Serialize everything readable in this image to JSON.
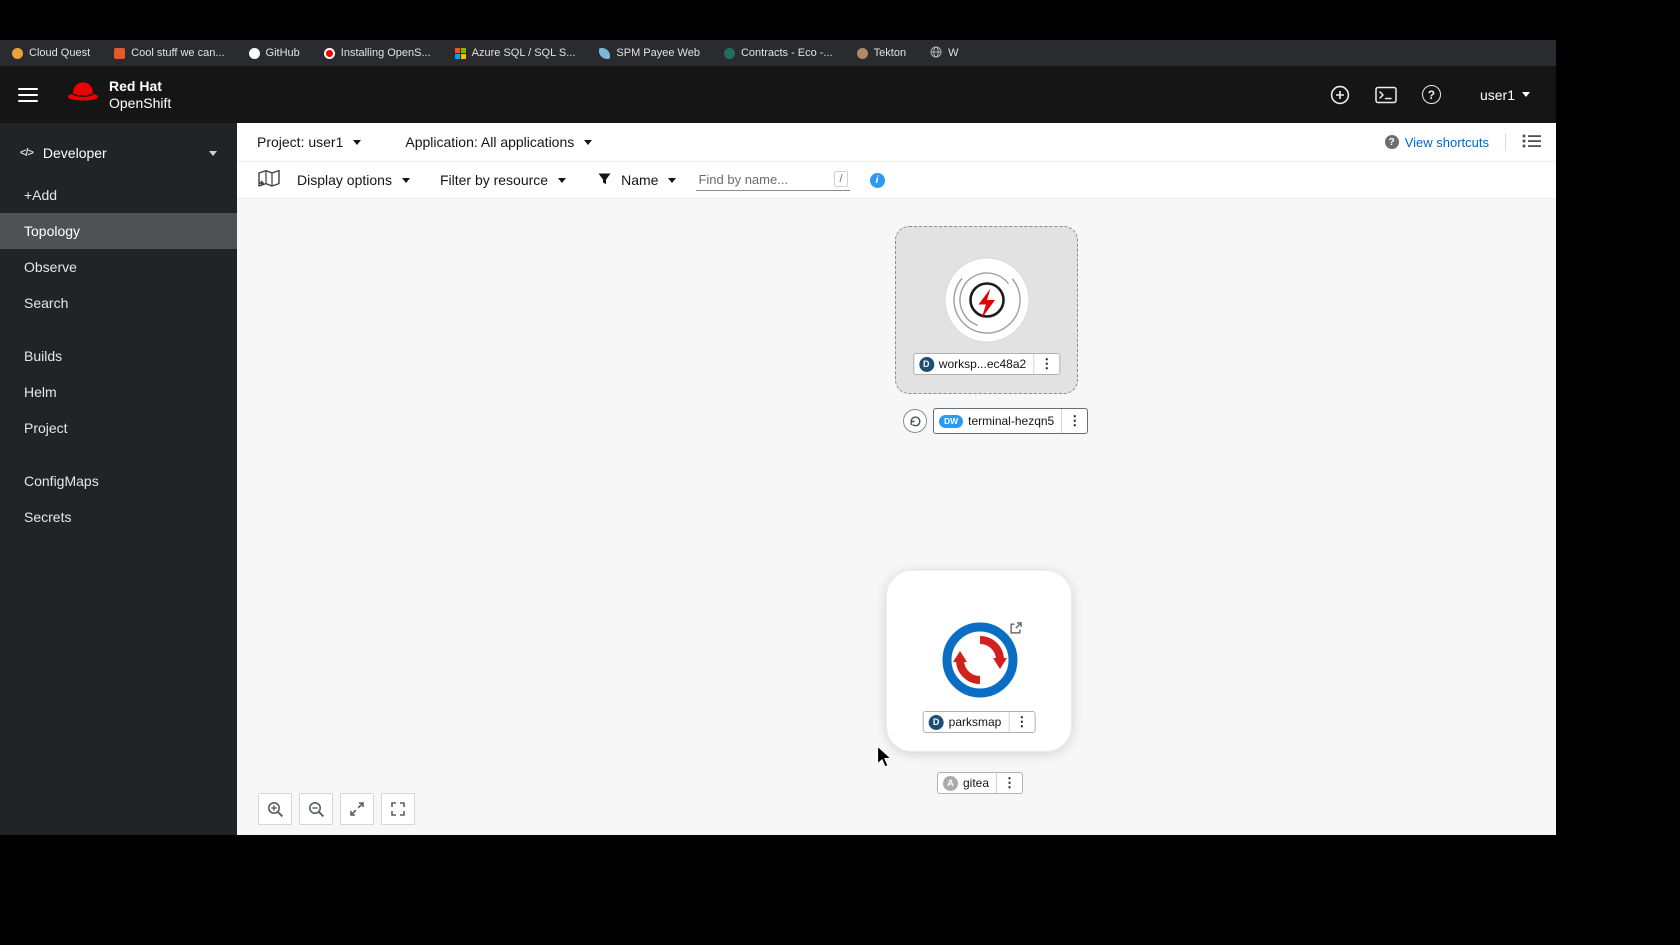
{
  "browser": {
    "bookmarks": [
      {
        "label": "Cloud Quest"
      },
      {
        "label": "Cool stuff we can..."
      },
      {
        "label": "GitHub"
      },
      {
        "label": "Installing OpenS..."
      },
      {
        "label": "Azure SQL / SQL S..."
      },
      {
        "label": "SPM Payee Web"
      },
      {
        "label": "Contracts - Eco -..."
      },
      {
        "label": "Tekton"
      },
      {
        "label": "W"
      }
    ]
  },
  "masthead": {
    "brand_line1": "Red Hat",
    "brand_line2": "OpenShift",
    "user_menu": "user1"
  },
  "sidebar": {
    "perspective_label": "Developer",
    "groups": [
      {
        "items": [
          {
            "label": "+Add"
          },
          {
            "label": "Topology"
          },
          {
            "label": "Observe"
          },
          {
            "label": "Search"
          }
        ]
      },
      {
        "items": [
          {
            "label": "Builds"
          },
          {
            "label": "Helm"
          },
          {
            "label": "Project"
          }
        ]
      },
      {
        "items": [
          {
            "label": "ConfigMaps"
          },
          {
            "label": "Secrets"
          }
        ]
      }
    ]
  },
  "context_bar": {
    "project": "Project: user1",
    "application": "Application: All applications",
    "view_shortcuts": "View shortcuts"
  },
  "filter_bar": {
    "display_options": "Display options",
    "filter_by_resource": "Filter by resource",
    "name_filter": "Name",
    "find_placeholder": "Find by name...",
    "shortcut_key": "/"
  },
  "topology": {
    "workspace": {
      "badge": "D",
      "label": "worksp...ec48a2"
    },
    "terminal": {
      "badge": "DW",
      "label": "terminal-hezqn5"
    },
    "parksmap": {
      "badge": "D",
      "label": "parksmap"
    },
    "gitea": {
      "badge": "A",
      "label": "gitea"
    }
  },
  "icons": {
    "kebab": "⋮",
    "code": "</>",
    "question": "?",
    "info": "i"
  },
  "colors": {
    "brand_red": "#ee0000",
    "link_blue": "#0066cc",
    "info_blue": "#2b9af3",
    "badge_deployment": "#1d4e74",
    "badge_devworkspace": "#2b9af3",
    "badge_application": "#a8abb0",
    "masthead_bg": "#151515",
    "sidebar_bg": "#212427",
    "sidebar_active_bg": "#4f5255",
    "canvas_bg": "#f7f7f7"
  }
}
